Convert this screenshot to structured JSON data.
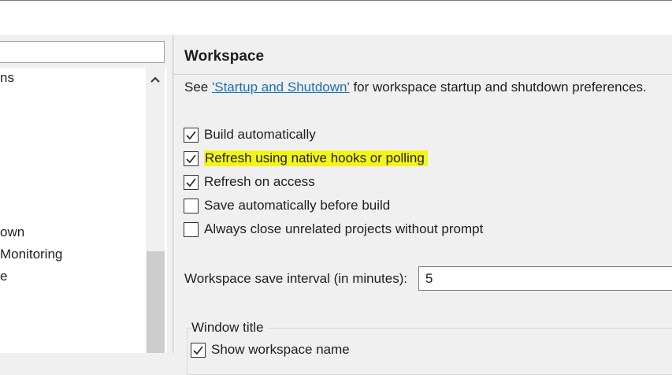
{
  "left": {
    "tree_items": [
      {
        "label": "ns"
      },
      {
        "label": "own"
      },
      {
        "label": "Monitoring"
      },
      {
        "label": "e"
      }
    ]
  },
  "workspace": {
    "title": "Workspace",
    "desc_prefix": "See ",
    "desc_link": "'Startup and Shutdown'",
    "desc_suffix": " for workspace startup and shutdown preferences.",
    "options": [
      {
        "label": "Build automatically",
        "checked": true
      },
      {
        "label": "Refresh using native hooks or polling",
        "checked": true,
        "highlighted": true
      },
      {
        "label": "Refresh on access",
        "checked": true
      },
      {
        "label": "Save automatically before build",
        "checked": false
      },
      {
        "label": "Always close unrelated projects without prompt",
        "checked": false
      }
    ],
    "interval_label": "Workspace save interval (in minutes):",
    "interval_value": "5",
    "window_title_group": "Window title",
    "show_workspace_name": "Show workspace name"
  },
  "colors": {
    "highlight": "#f4f514",
    "link": "#1a6fb5"
  }
}
